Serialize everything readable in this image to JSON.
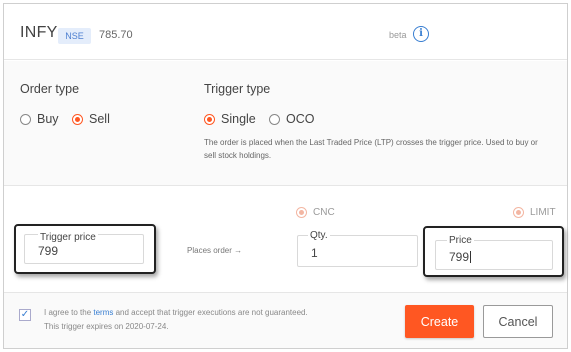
{
  "header": {
    "symbol": "INFY",
    "exchange": "NSE",
    "ltp": "785.70",
    "beta_label": "beta",
    "info_icon": "info-icon"
  },
  "order_type": {
    "heading": "Order type",
    "options": [
      {
        "label": "Buy",
        "selected": false
      },
      {
        "label": "Sell",
        "selected": true
      }
    ]
  },
  "trigger_type": {
    "heading": "Trigger type",
    "options": [
      {
        "label": "Single",
        "selected": true
      },
      {
        "label": "OCO",
        "selected": false
      }
    ],
    "description": "The order is placed when the Last Traded Price (LTP) crosses the trigger price. Used to buy or sell stock holdings."
  },
  "product": {
    "cnc_label": "CNC",
    "limit_label": "LIMIT"
  },
  "inputs": {
    "trigger_price_label": "Trigger price",
    "trigger_price_value": "799",
    "places_order_text": "Places order →",
    "qty_label": "Qty.",
    "qty_value": "1",
    "price_label": "Price",
    "price_value": "799"
  },
  "footer": {
    "agree_prefix": "I agree to the ",
    "terms_link": "terms",
    "agree_suffix": " and accept that trigger executions are not guaranteed. This trigger expires on 2020-07-24.",
    "checked": true,
    "create_label": "Create",
    "cancel_label": "Cancel"
  },
  "colors": {
    "accent": "#ff5722",
    "link": "#387ed1"
  }
}
